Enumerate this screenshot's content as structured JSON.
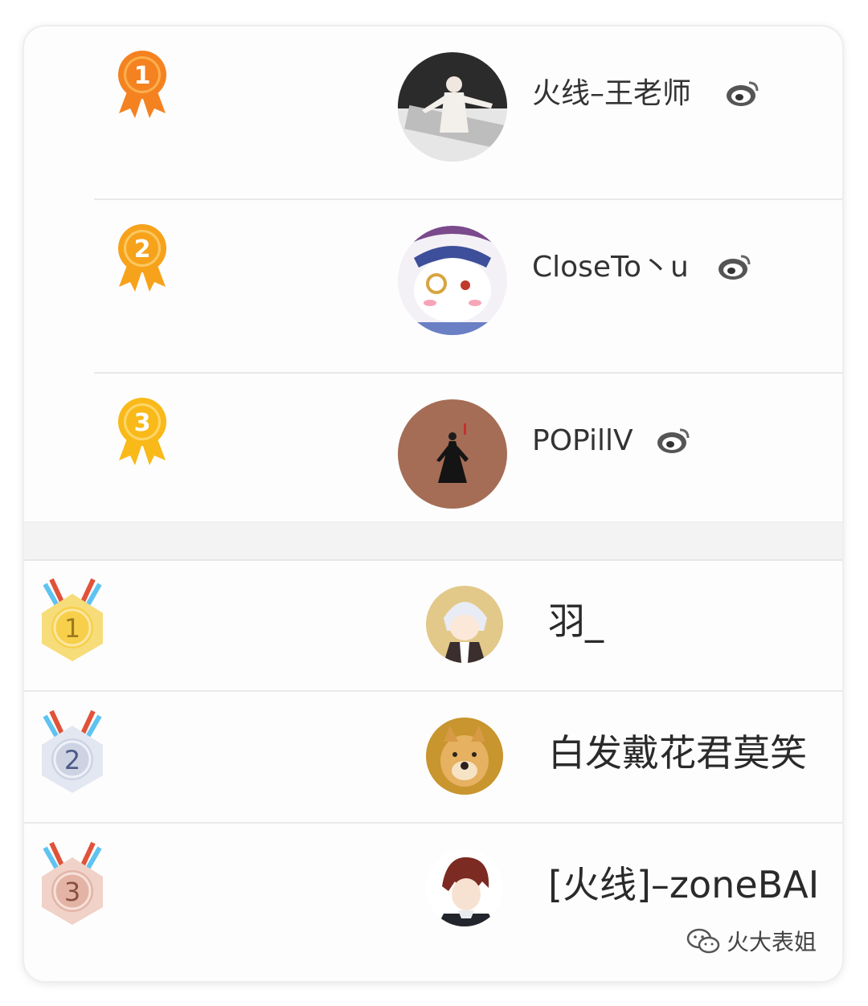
{
  "top_ranking": [
    {
      "rank": "1",
      "name": "火线–王老师",
      "verified_icon": "weibo-icon",
      "badge_color": "#f58220"
    },
    {
      "rank": "2",
      "name": "CloseTo丶u",
      "verified_icon": "weibo-icon",
      "badge_color": "#f7a21b"
    },
    {
      "rank": "3",
      "name": "POPillV",
      "verified_icon": "weibo-icon",
      "badge_color": "#f9b919"
    }
  ],
  "bottom_ranking": [
    {
      "rank": "1",
      "name": "羽_",
      "medal": "gold"
    },
    {
      "rank": "2",
      "name": "白发戴花君莫笑",
      "medal": "silver"
    },
    {
      "rank": "3",
      "name": "[火线]–zoneBAI",
      "medal": "bronze"
    }
  ],
  "watermark": {
    "text": "火大表姐",
    "icon": "wechat-icon"
  },
  "colors": {
    "gold": "#f7cf4a",
    "silver": "#cdd3e3",
    "bronze": "#e3b4a6",
    "ribbon_red": "#e0533a",
    "ribbon_blue": "#5fc3f0"
  }
}
